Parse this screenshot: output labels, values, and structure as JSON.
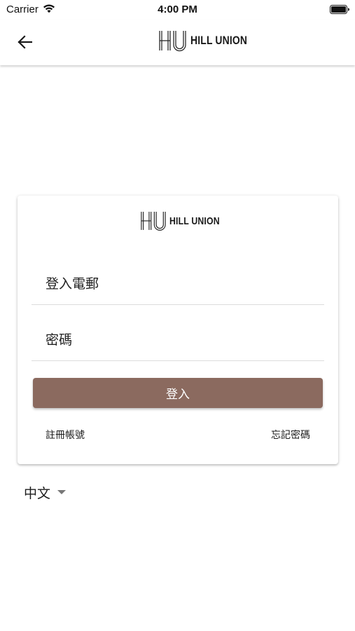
{
  "status_bar": {
    "carrier": "Carrier",
    "time": "4:00 PM",
    "wifi_icon": "wifi-icon",
    "battery_icon": "battery-icon"
  },
  "app_bar": {
    "back_icon": "arrow-left-icon",
    "brand_name": "HILL UNION",
    "logo_icon": "hill-union-monogram"
  },
  "login_card": {
    "brand_name": "HILL UNION",
    "email_placeholder": "登入電郵",
    "password_placeholder": "密碼",
    "login_label": "登入",
    "register_label": "註冊帳號",
    "forgot_label": "忘記密碼"
  },
  "language": {
    "selected": "中文"
  },
  "colors": {
    "button": "#8b6a5f",
    "background": "#ffffff",
    "text": "#1b1b1b"
  }
}
